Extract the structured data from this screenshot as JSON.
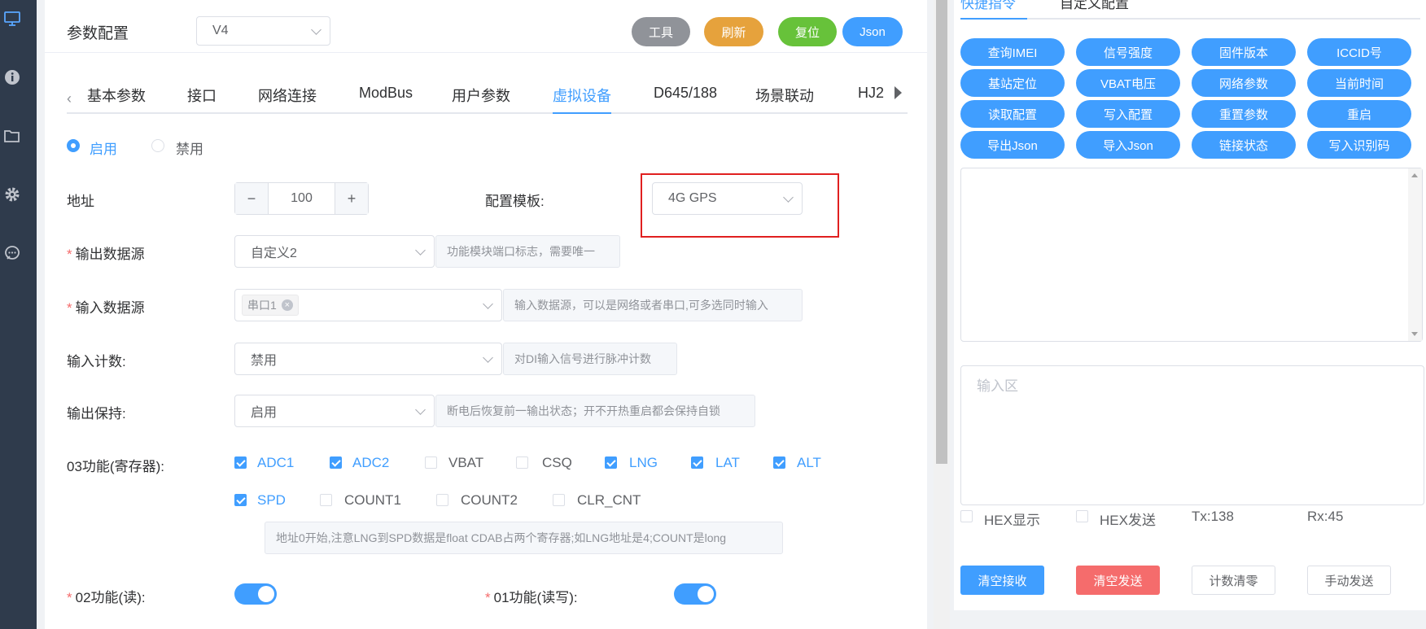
{
  "sidebar": {
    "icons": [
      "monitor-icon",
      "info-icon",
      "folder-icon",
      "gear-icon",
      "chat-icon"
    ]
  },
  "header": {
    "title": "参数配置",
    "version_select": "V4",
    "buttons": {
      "tools": "工具",
      "refresh": "刷新",
      "reset": "复位",
      "json": "Json"
    }
  },
  "tabs": {
    "items": [
      "基本参数",
      "接口",
      "网络连接",
      "ModBus",
      "用户参数",
      "虚拟设备",
      "D645/188",
      "场景联动",
      "HJ2"
    ],
    "active": "虚拟设备"
  },
  "form": {
    "radio_enable": "启用",
    "radio_disable": "禁用",
    "address_label": "地址",
    "address_value": "100",
    "stepper_minus": "−",
    "stepper_plus": "+",
    "template_label": "配置模板:",
    "template_value": "4G GPS",
    "output_source_label": "输出数据源",
    "output_source_value": "自定义2",
    "output_source_hint": "功能模块端口标志，需要唯一",
    "input_source_label": "输入数据源",
    "input_source_tag": "串口1",
    "input_source_hint": "输入数据源，可以是网络或者串口,可多选同时输入",
    "input_count_label": "输入计数:",
    "input_count_value": "禁用",
    "input_count_hint": "对DI输入信号进行脉冲计数",
    "output_hold_label": "输出保持:",
    "output_hold_value": "启用",
    "output_hold_hint": "断电后恢复前一输出状态；开不开热重启都会保持自锁",
    "func03_label": "03功能(寄存器):",
    "func03_row1": [
      {
        "label": "ADC1",
        "checked": true
      },
      {
        "label": "ADC2",
        "checked": true
      },
      {
        "label": "VBAT",
        "checked": false
      },
      {
        "label": "CSQ",
        "checked": false
      },
      {
        "label": "LNG",
        "checked": true
      },
      {
        "label": "LAT",
        "checked": true
      },
      {
        "label": "ALT",
        "checked": true
      }
    ],
    "func03_row2": [
      {
        "label": "SPD",
        "checked": true
      },
      {
        "label": "COUNT1",
        "checked": false
      },
      {
        "label": "COUNT2",
        "checked": false
      },
      {
        "label": "CLR_CNT",
        "checked": false
      }
    ],
    "func03_hint": "地址0开始,注意LNG到SPD数据是float CDAB占两个寄存器;如LNG地址是4;COUNT是long",
    "func02_label": "02功能(读):",
    "func02_on": true,
    "func01_label": "01功能(读写):",
    "func01_on": true
  },
  "right_panel": {
    "tab_quick": "快捷指令",
    "tab_custom": "自定义配置",
    "quick_buttons": [
      "查询IMEI",
      "信号强度",
      "固件版本",
      "ICCID号",
      "基站定位",
      "VBAT电压",
      "网络参数",
      "当前时间",
      "读取配置",
      "写入配置",
      "重置参数",
      "重启",
      "导出Json",
      "导入Json",
      "链接状态",
      "写入识别码"
    ],
    "input_placeholder": "输入区",
    "hex_display": "HEX显示",
    "hex_send": "HEX发送",
    "tx": "Tx:138",
    "rx": "Rx:45",
    "btn_clear_recv": "清空接收",
    "btn_clear_send": "清空发送",
    "btn_reset_count": "计数清零",
    "btn_manual_send": "手动发送"
  },
  "colors": {
    "primary": "#409eff",
    "gray_btn": "#909399",
    "orange_btn": "#e6a23c",
    "green_btn": "#67c23a",
    "danger_btn": "#f56c6c",
    "highlight_box": "#e02020",
    "sidebar_bg": "#2f3b4c"
  }
}
